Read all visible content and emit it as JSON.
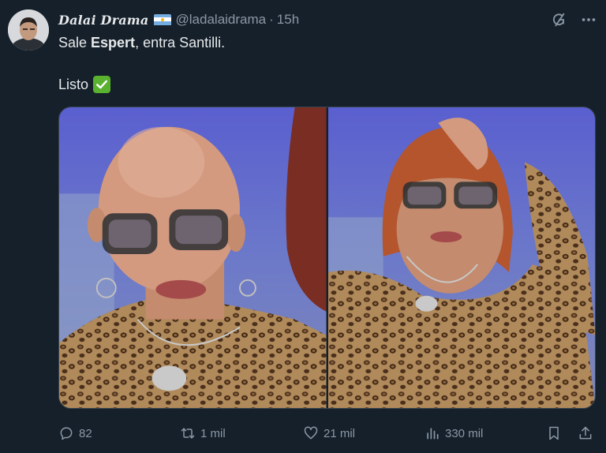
{
  "tweet": {
    "display_name": "Dalai Drama",
    "handle": "@ladalaidrama",
    "separator": "·",
    "time": "15h",
    "text": {
      "before": "Sale ",
      "bold": "Espert",
      "after": ", entra Santilli.",
      "line2": "Listo"
    }
  },
  "actions": {
    "replies": "82",
    "retweets": "1 mil",
    "likes": "21 mil",
    "views": "330 mil"
  },
  "icons": {
    "flag": "argentina-flag-icon",
    "grok": "grok-icon",
    "more": "more-icon",
    "check": "check-mark-icon",
    "reply": "reply-icon",
    "retweet": "retweet-icon",
    "like": "heart-icon",
    "views": "views-icon",
    "bookmark": "bookmark-icon",
    "share": "share-icon"
  },
  "colors": {
    "background": "#15202b",
    "text": "#e7e9ea",
    "muted": "#8b98a5",
    "check_green": "#5ab02f"
  }
}
